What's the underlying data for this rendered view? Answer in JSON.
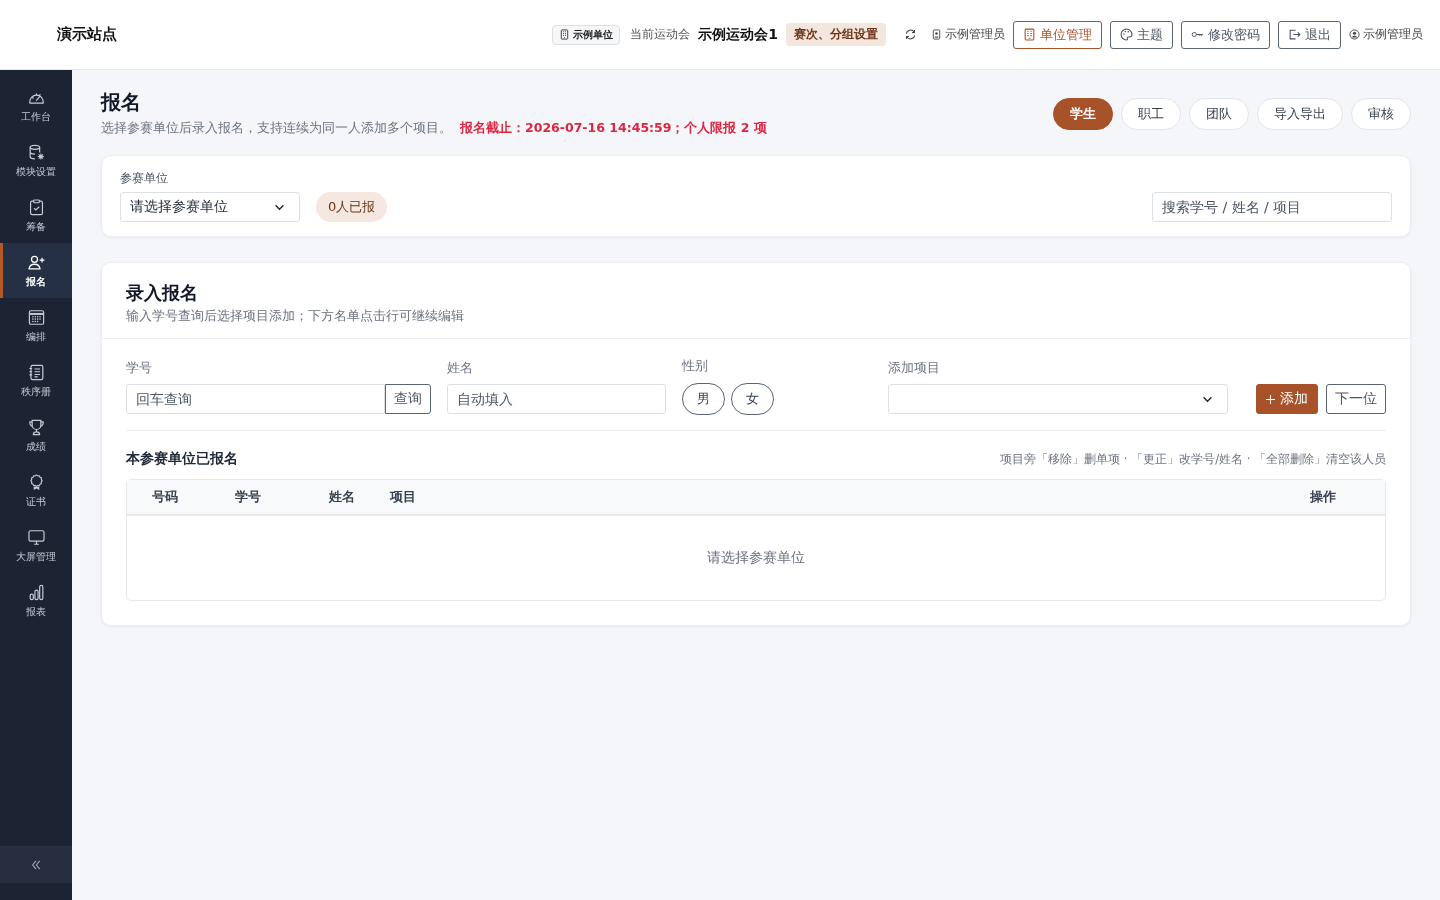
{
  "header": {
    "site_title": "演示站点",
    "unit_badge": "示例单位",
    "current_meet_label": "当前运动会",
    "current_meet": "示例运动会1",
    "meet_settings": "赛次、分组设置",
    "admin_role": "示例管理员",
    "buttons": [
      {
        "label": "单位管理",
        "kind": "accent"
      },
      {
        "label": "主题",
        "kind": "outline"
      },
      {
        "label": "修改密码",
        "kind": "outline"
      },
      {
        "label": "退出",
        "kind": "outline"
      }
    ],
    "user": "示例管理员"
  },
  "sidebar": {
    "items": [
      {
        "label": "工作台",
        "selected": false
      },
      {
        "label": "模块设置",
        "selected": false
      },
      {
        "label": "筹备",
        "selected": false
      },
      {
        "label": "报名",
        "selected": true
      },
      {
        "label": "编排",
        "selected": false
      },
      {
        "label": "秩序册",
        "selected": false
      },
      {
        "label": "成绩",
        "selected": false
      },
      {
        "label": "证书",
        "selected": false
      },
      {
        "label": "大屏管理",
        "selected": false
      },
      {
        "label": "报表",
        "selected": false
      }
    ]
  },
  "page": {
    "title": "报名",
    "subtitle": "选择参赛单位后录入报名，支持连续为同一人添加多个项目。",
    "notice": "报名截止：2026-07-16 14:45:59；个人限报 2 项",
    "tabs": [
      {
        "label": "学生",
        "selected": true
      },
      {
        "label": "职工",
        "selected": false
      },
      {
        "label": "团队",
        "selected": false
      },
      {
        "label": "导入导出",
        "selected": false
      },
      {
        "label": "审核",
        "selected": false
      }
    ]
  },
  "filter_card": {
    "unit_label": "参赛单位",
    "unit_select": "请选择参赛单位",
    "count_badge": "0人已报",
    "search": {
      "placeholder": "搜索学号 / 姓名 / 项目"
    }
  },
  "entry_card": {
    "title": "录入报名",
    "subtitle": "输入学号查询后选择项目添加；下方名单点击行可继续编辑",
    "student_id": {
      "label": "学号",
      "placeholder": "回车查询",
      "button": "查询"
    },
    "name": {
      "label": "姓名",
      "placeholder": "自动填入"
    },
    "gender": {
      "label": "性别",
      "options": [
        {
          "label": "男",
          "selected": false
        },
        {
          "label": "女",
          "selected": false
        }
      ]
    },
    "event": {
      "label": "添加项目"
    },
    "add_button": "添加",
    "next_button": "下一位"
  },
  "registered": {
    "title": "本参赛单位已报名",
    "hint": "项目旁「移除」删单项 · 「更正」改学号/姓名 · 「全部删除」清空该人员",
    "table": {
      "columns": [
        "号码",
        "学号",
        "姓名",
        "项目",
        "操作"
      ],
      "empty_text": "请选择参赛单位"
    }
  }
}
